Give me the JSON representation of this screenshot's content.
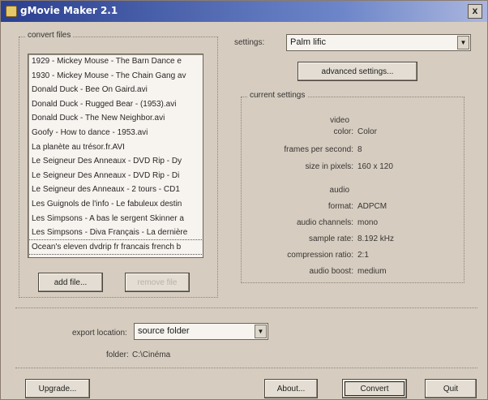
{
  "window": {
    "title": "gMovie Maker 2.1",
    "close_label": "x"
  },
  "convert": {
    "group_label": "convert files",
    "files": [
      "1929 - Mickey Mouse - The Barn Dance e",
      "1930 - Mickey Mouse - The Chain Gang av",
      "Donald Duck - Bee On Gaird.avi",
      "Donald Duck - Rugged Bear - (1953).avi",
      "Donald Duck - The New Neighbor.avi",
      "Goofy - How to dance - 1953.avi",
      "La planète au trésor.fr.AVI",
      "Le Seigneur Des Anneaux - DVD Rip - Dy",
      "Le Seigneur Des Anneaux - DVD Rip - Di",
      "Le Seigneur des Anneaux - 2 tours - CD1",
      "Les Guignols de l'info - Le fabuleux destin",
      "Les Simpsons - A bas le sergent Skinner a",
      "Les Simpsons - Diva Français - La dernière",
      "Ocean's eleven dvdrip fr francais french b"
    ],
    "add_file_label": "add file...",
    "remove_file_label": "remove file"
  },
  "settings": {
    "label": "settings:",
    "selected": "Palm lific",
    "advanced_label": "advanced settings...",
    "current_label": "current settings",
    "video_heading": "video",
    "video": [
      {
        "label": "color:",
        "value": "Color"
      },
      {
        "label": "frames per second:",
        "value": "8"
      },
      {
        "label": "size in pixels:",
        "value": "160 x 120"
      }
    ],
    "audio_heading": "audio",
    "audio": [
      {
        "label": "format:",
        "value": "ADPCM"
      },
      {
        "label": "audio channels:",
        "value": "mono"
      },
      {
        "label": "sample rate:",
        "value": "8.192 kHz"
      },
      {
        "label": "compression ratio:",
        "value": "2:1"
      },
      {
        "label": "audio boost:",
        "value": "medium"
      }
    ]
  },
  "export": {
    "label": "export location:",
    "selected": "source folder",
    "folder_label": "folder:",
    "folder_value": "C:\\Cinéma"
  },
  "buttons": {
    "upgrade": "Upgrade...",
    "about": "About...",
    "convert": "Convert",
    "quit": "Quit"
  }
}
